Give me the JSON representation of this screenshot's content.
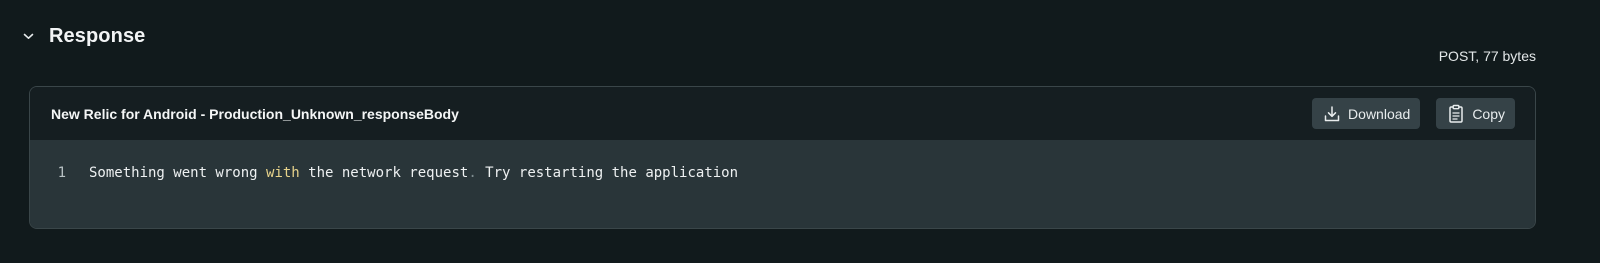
{
  "section": {
    "title": "Response",
    "meta": "POST, 77 bytes"
  },
  "code_card": {
    "file_name": "New Relic for Android - Production_Unknown_responseBody",
    "download_label": "Download",
    "copy_label": "Copy",
    "lines": [
      {
        "number": "1",
        "tokens": {
          "t1": "Something went wrong ",
          "t2": "with",
          "t3": " the network request",
          "t4": ".",
          "t5": " Try restarting the application"
        }
      }
    ]
  },
  "colors": {
    "background": "#111a1c",
    "code_background": "#293539",
    "button_background": "#354247",
    "keyword": "#e7d38b"
  },
  "icons": [
    "chevron-down-icon",
    "download-icon",
    "clipboard-icon"
  ]
}
